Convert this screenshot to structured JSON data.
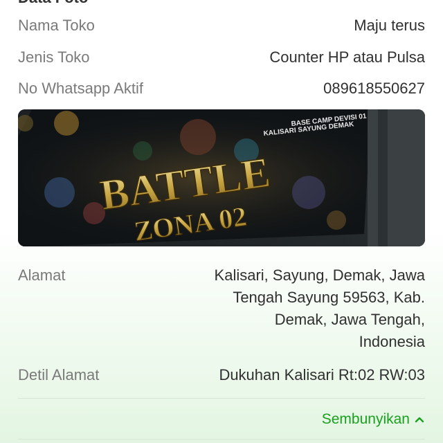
{
  "section": {
    "title": "Data Foto"
  },
  "fields": [
    {
      "label": "Nama Toko",
      "value": "Maju terus"
    },
    {
      "label": "Jenis Toko",
      "value": "Counter HP atau Pulsa"
    },
    {
      "label": "No Whatsapp Aktif",
      "value": "089618550627"
    }
  ],
  "photo": {
    "sign_small_line1": "BASE CAMP DEVISI 01",
    "sign_small_line2": "KALISARI SAYUNG DEMAK",
    "sign_title": "BATTLE",
    "sign_subtitle": "ZONA 02"
  },
  "address": {
    "label": "Alamat",
    "lines": [
      "Kalisari, Sayung, Demak, Jawa",
      "Tengah Sayung 59563, Kab.",
      "Demak, Jawa Tengah,",
      "Indonesia"
    ]
  },
  "detail_address": {
    "label": "Detil Alamat",
    "value": "Dukuhan Kalisari Rt:02 RW:03"
  },
  "toggle": {
    "label": "Sembunyikan",
    "icon": "chevron-up-icon"
  },
  "colors": {
    "accent": "#1aa01f",
    "label": "#7a7a7a",
    "value": "#303030"
  }
}
